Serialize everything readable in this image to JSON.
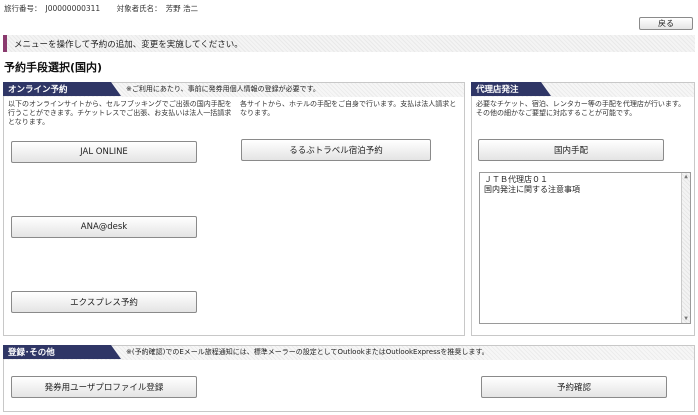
{
  "topinfo": {
    "trip_no_label": "旅行番号：",
    "trip_no": "J00000000311",
    "person_label": "対象者氏名：",
    "person_name": "芳野 浩二"
  },
  "back_label": "戻る",
  "message": "メニューを操作して予約の追加、変更を実施してください。",
  "page_title": "予約手段選択(国内)",
  "online": {
    "tab": "オンライン予約",
    "note": "※ご利用にあたり、事前に発券用個人情報の登録が必要です。",
    "desc_left": "以下のオンラインサイトから、セルフブッキングでご出張の国内手配を行うことができます。チケットレスでご出張、お支払いは法人一括請求となります。",
    "desc_right": "各サイトから、ホテルの手配をご自身で行います。支払は法人請求となります。",
    "buttons": {
      "jal": "JAL ONLINE",
      "rurubu": "るるぶトラベル宿泊予約",
      "ana": "ANA@desk",
      "express": "エクスプレス予約"
    }
  },
  "agency": {
    "tab": "代理店発注",
    "desc": "必要なチケット、宿泊、レンタカー等の手配を代理店が行います。その他の細かなご要望に対応することが可能です。",
    "button": "国内手配",
    "textbox_line1": "ＪＴＢ代理店０１",
    "textbox_line2": "国内発注に関する注意事項"
  },
  "registration": {
    "tab": "登録･その他",
    "note": "※(予約確認)でのEメール旅程通知には、標準メーラーの設定としてOutlookまたはOutlookExpressを推奨します。",
    "profile_button": "発券用ユーザプロファイル登録",
    "confirm_button": "予約確認"
  },
  "colors": {
    "tab_bg": "#2f3666",
    "accent": "#8a3a6e"
  }
}
